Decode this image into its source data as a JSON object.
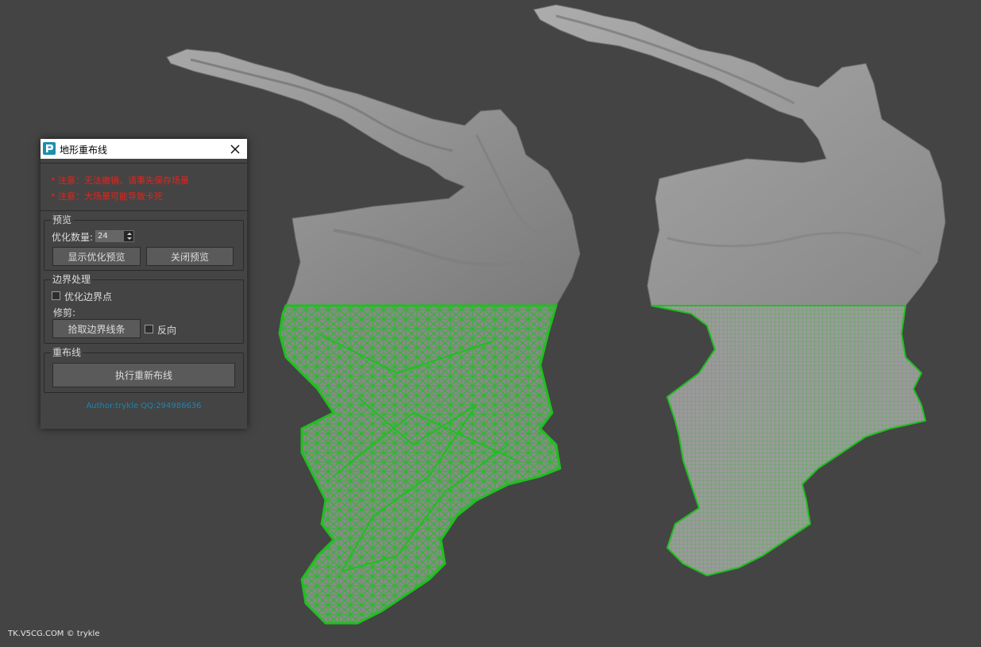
{
  "dialog": {
    "title": "地形重布线",
    "notes": [
      "* 注意：无法撤销，请事先保存场景",
      "* 注意：大场景可能导致卡死"
    ],
    "preview": {
      "legend": "预览",
      "count_label": "优化数量:",
      "count_value": "24",
      "show_button": "显示优化预览",
      "close_button": "关闭预览"
    },
    "boundary": {
      "legend": "边界处理",
      "optimize_label": "优化边界点",
      "trim_label": "修剪:",
      "pick_button": "拾取边界线条",
      "reverse_label": "反向"
    },
    "retopo": {
      "legend": "重布线",
      "run_button": "执行重新布线"
    },
    "author": "Author:trykle QQ:294986636"
  },
  "watermark": "TK.V5CG.COM © trykle",
  "colors": {
    "viewport_bg": "#444444",
    "mesh_gray": "#9a9a9a",
    "wire_green": "#1fbf1f",
    "note_red": "#e8221a",
    "author_blue": "#1a86b3"
  }
}
